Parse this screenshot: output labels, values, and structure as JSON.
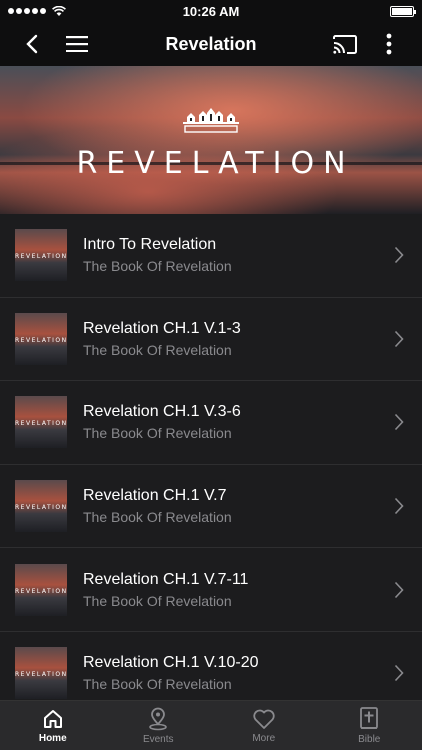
{
  "status": {
    "time": "10:26 AM"
  },
  "nav": {
    "title": "Revelation"
  },
  "banner": {
    "title": "REVELATION"
  },
  "thumb_text": "REVELATION",
  "items": [
    {
      "title": "Intro To Revelation",
      "subtitle": "The Book Of Revelation"
    },
    {
      "title": "Revelation CH.1 V.1-3",
      "subtitle": "The Book Of Revelation"
    },
    {
      "title": "Revelation CH.1 V.3-6",
      "subtitle": "The Book Of Revelation"
    },
    {
      "title": "Revelation CH.1 V.7",
      "subtitle": "The Book Of Revelation"
    },
    {
      "title": "Revelation CH.1 V.7-11",
      "subtitle": "The Book Of Revelation"
    },
    {
      "title": "Revelation CH.1 V.10-20",
      "subtitle": "The Book Of Revelation"
    }
  ],
  "tabs": [
    {
      "label": "Home",
      "icon": "home-icon",
      "active": true
    },
    {
      "label": "Events",
      "icon": "location-pin-icon",
      "active": false
    },
    {
      "label": "More",
      "icon": "heart-icon",
      "active": false
    },
    {
      "label": "Bible",
      "icon": "bible-icon",
      "active": false
    }
  ],
  "colors": {
    "background": "#1c1c1e",
    "bar": "#0e0e0f",
    "subtitle": "#8a8a8e",
    "tab_bar": "#2a2a2c"
  }
}
